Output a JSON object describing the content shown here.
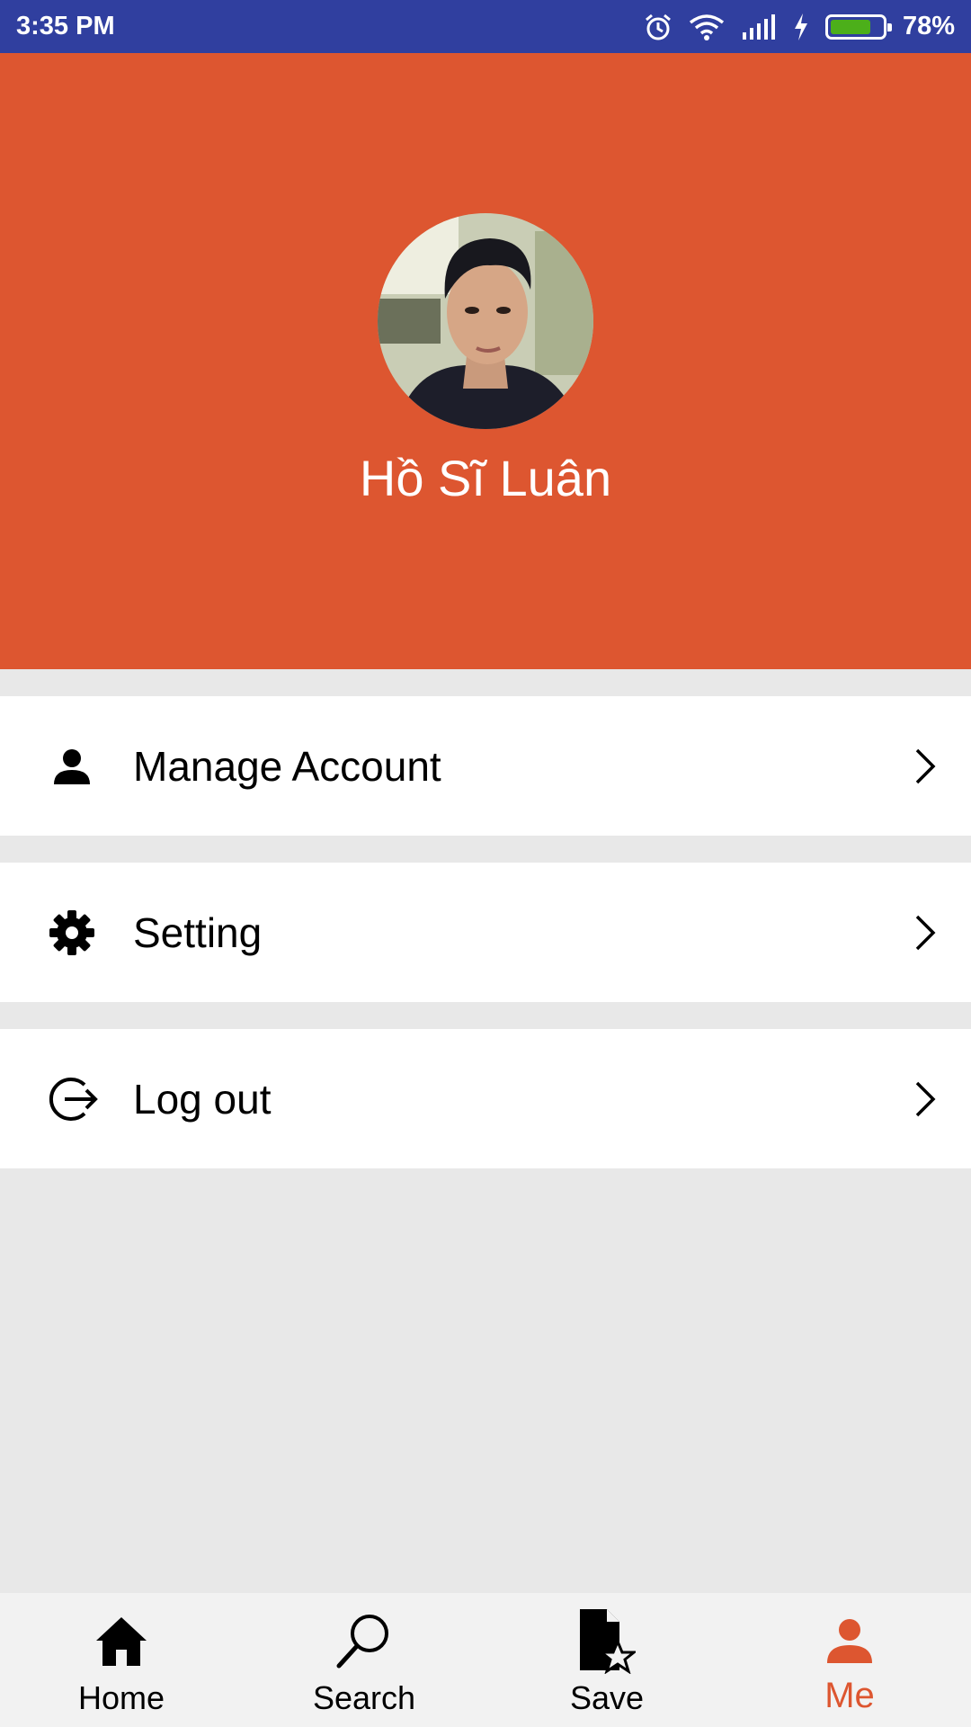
{
  "status_bar": {
    "time": "3:35 PM",
    "battery_percent": "78%",
    "battery_level": 0.78,
    "icons": [
      "alarm-icon",
      "wifi-icon",
      "signal-icon",
      "charging-icon",
      "battery-icon"
    ]
  },
  "profile": {
    "name": "Hồ Sĩ Luân",
    "header_color": "#dd5630"
  },
  "menu": {
    "items": [
      {
        "label": "Manage Account",
        "icon": "person-icon"
      },
      {
        "label": "Setting",
        "icon": "gear-icon"
      },
      {
        "label": "Log out",
        "icon": "logout-icon"
      }
    ]
  },
  "bottom_nav": {
    "items": [
      {
        "label": "Home",
        "icon": "home-icon"
      },
      {
        "label": "Search",
        "icon": "search-icon"
      },
      {
        "label": "Save",
        "icon": "save-icon"
      },
      {
        "label": "Me",
        "icon": "person-icon",
        "active": true
      }
    ],
    "active_color": "#dd5630"
  }
}
